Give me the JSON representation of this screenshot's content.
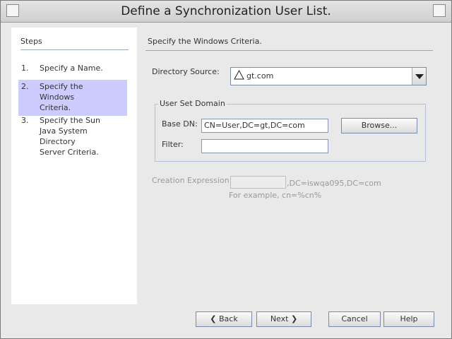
{
  "window": {
    "title": "Define a Synchronization User List."
  },
  "steps": {
    "heading": "Steps",
    "items": [
      {
        "num": "1.",
        "label": "Specify a Name."
      },
      {
        "num": "2.",
        "label": "Specify the Windows Criteria."
      },
      {
        "num": "3.",
        "label": "Specify the Sun Java System Directory Server Criteria."
      }
    ]
  },
  "main": {
    "heading": "Specify the Windows Criteria.",
    "directory_source": {
      "label": "Directory Source:",
      "value": "gt.com"
    },
    "user_set_domain": {
      "legend": "User Set Domain",
      "base_dn_label": "Base DN:",
      "base_dn_value": "CN=User,DC=gt,DC=com",
      "filter_label": "Filter:",
      "filter_value": "",
      "browse_label": "Browse..."
    },
    "creation_expression": {
      "label": "Creation Expression:",
      "value": "",
      "suffix": ",DC=iswqa095,DC=com",
      "example": "For example, cn=%cn%"
    }
  },
  "footer": {
    "back_label": "Back",
    "next_label": "Next",
    "cancel_label": "Cancel",
    "help_label": "Help"
  }
}
